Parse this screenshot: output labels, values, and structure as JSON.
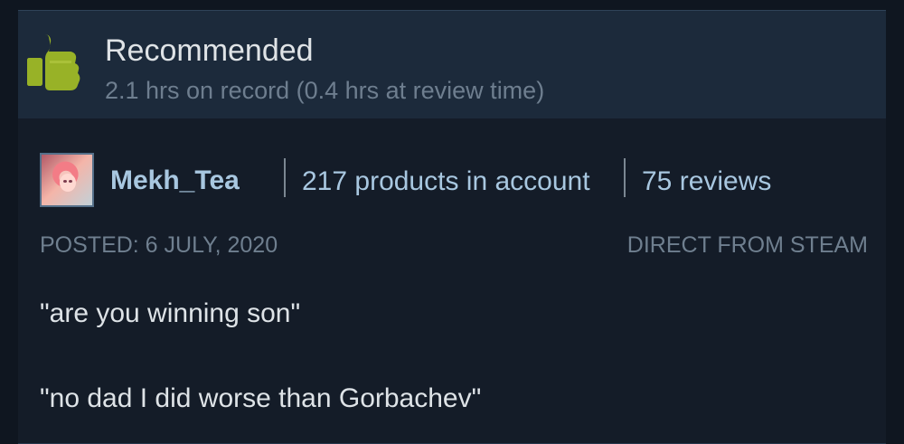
{
  "review": {
    "recommendation": "Recommended",
    "hours": "2.1 hrs on record (0.4 hrs at review time)",
    "author": {
      "username": "Mekh_Tea",
      "products": "217 products in account",
      "reviews": "75 reviews"
    },
    "posted": "POSTED: 6 JULY, 2020",
    "source": "DIRECT FROM STEAM",
    "body": [
      "\"are you winning son\"",
      "\"no dad I did worse than Gorbachev\""
    ]
  },
  "icons": {
    "recommendation": "thumbs-up-icon",
    "avatar": "user-avatar-image"
  },
  "colors": {
    "background": "#0f1620",
    "card": "#141c28",
    "header": "#1c2a3b",
    "thumb": "#98b227",
    "author_link": "#a8c7e0",
    "primary_text": "#dee3e7",
    "secondary_text": "#6f7f8f"
  }
}
